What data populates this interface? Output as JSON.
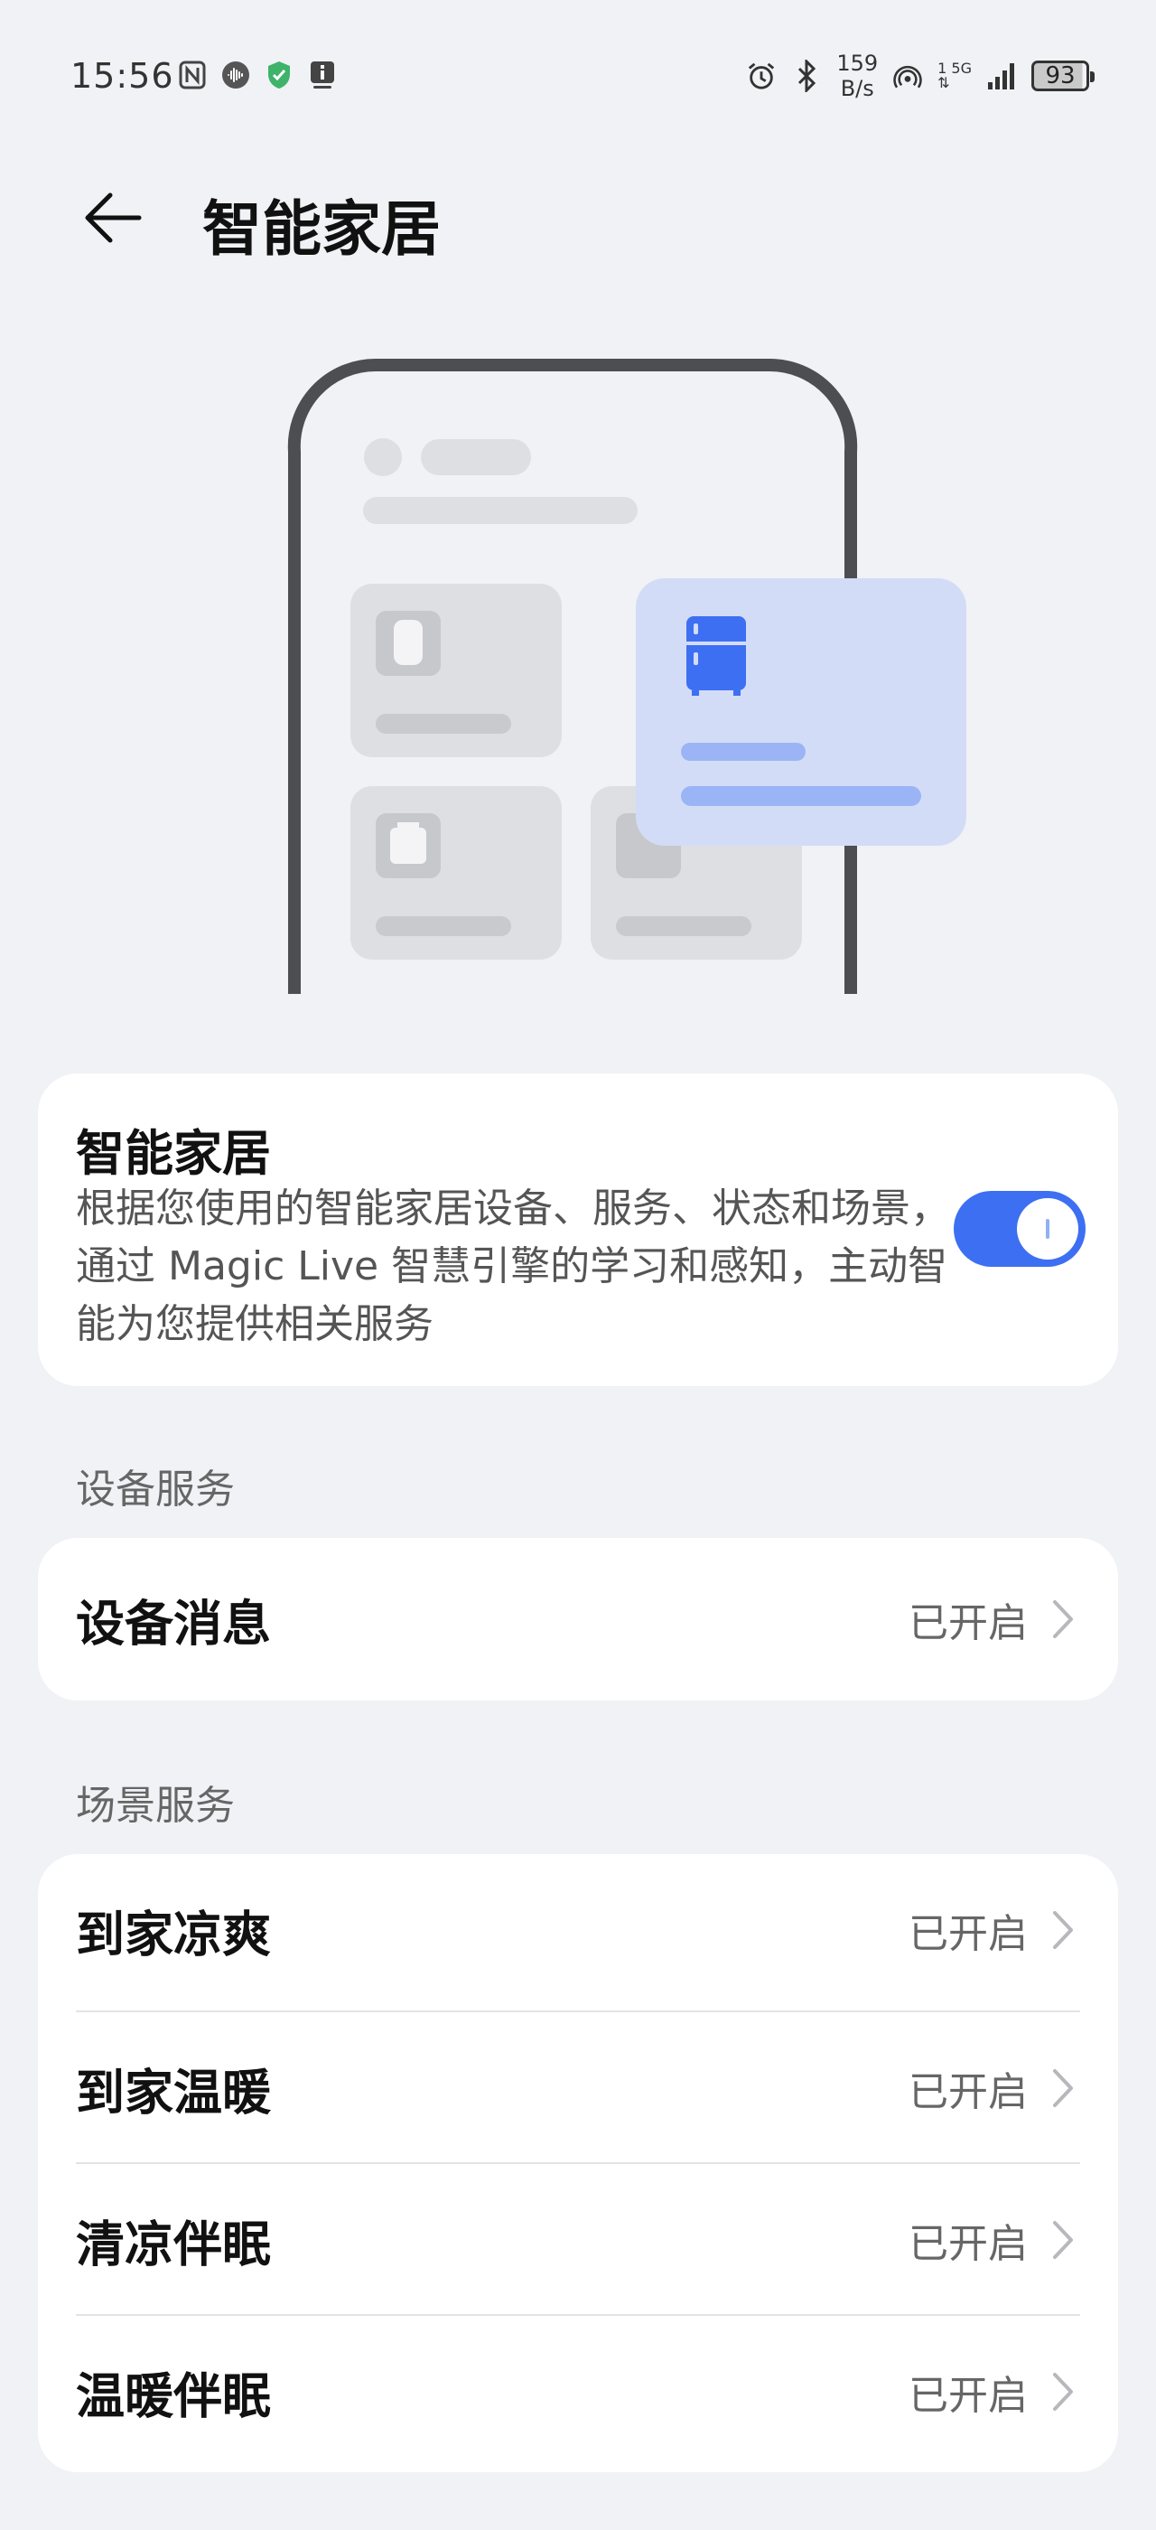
{
  "status_bar": {
    "time": "15:56",
    "speed_value": "159",
    "speed_unit": "B/s",
    "network_sup": "1",
    "network_type": "5G",
    "battery": "93",
    "left_icons": [
      "nfc-icon",
      "audio-wave-icon",
      "shield-check-icon",
      "info-badge-icon"
    ],
    "right_icons": [
      "alarm-icon",
      "bluetooth-icon",
      "hotspot-icon",
      "signal-icon"
    ]
  },
  "header": {
    "title": "智能家居",
    "back_icon": "arrow-left-icon"
  },
  "main_card": {
    "title": "智能家居",
    "description": "根据您使用的智能家居设备、服务、状态和场景，通过 Magic Live 智慧引擎的学习和感知，主动智能为您提供相关服务",
    "toggle_on": true
  },
  "sections": [
    {
      "label": "设备服务",
      "items": [
        {
          "label": "设备消息",
          "value": "已开启"
        }
      ]
    },
    {
      "label": "场景服务",
      "items": [
        {
          "label": "到家凉爽",
          "value": "已开启"
        },
        {
          "label": "到家温暖",
          "value": "已开启"
        },
        {
          "label": "清凉伴眠",
          "value": "已开启"
        },
        {
          "label": "温暖伴眠",
          "value": "已开启"
        }
      ]
    }
  ],
  "colors": {
    "background": "#f1f2f6",
    "accent": "#3d6ff2",
    "card": "#ffffff",
    "illustration_card": "#d3dcf7"
  }
}
